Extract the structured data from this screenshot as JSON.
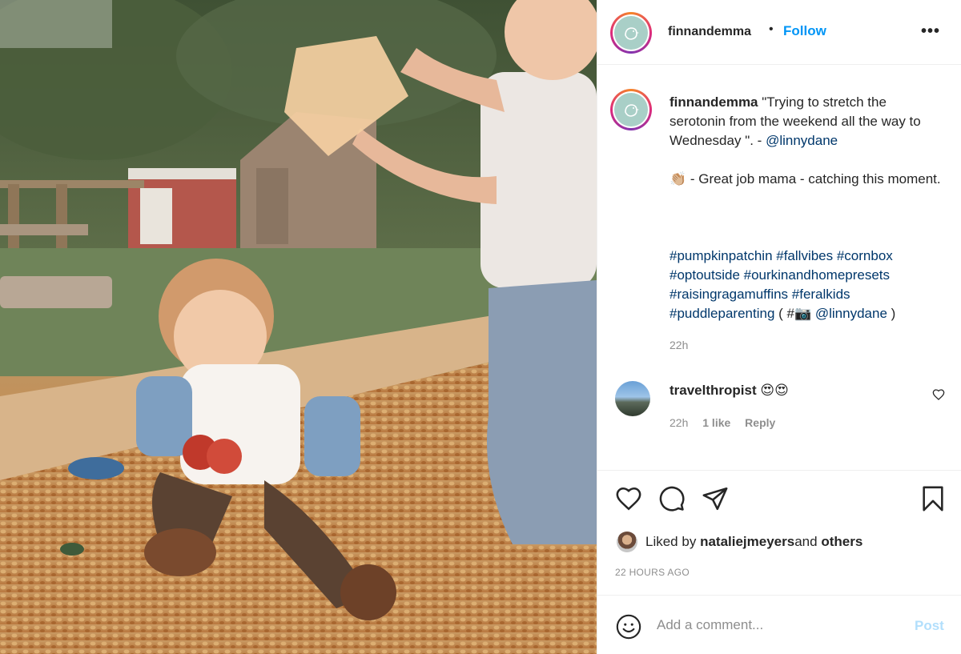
{
  "post": {
    "username": "finnandemma",
    "follow_label": "Follow",
    "more_label": "•••"
  },
  "caption": {
    "username": "finnandemma",
    "text": "\"Trying to stretch the serotonin from the weekend all the way to Wednesday \". - ",
    "mention": "@linnydane",
    "line2_emoji": "👏🏼",
    "line2_text": " - Great job mama - catching this moment.",
    "tags_text": "#pumpkinpatchin #fallvibes #cornbox #optoutside #ourkinandhomepresets #raisingragamuffins #feralkids #puddleparenting",
    "credit_prefix": " ( #",
    "credit_emoji": "📷",
    "credit_mention": " @linnydane",
    "credit_suffix": " )",
    "time": "22h"
  },
  "comment": {
    "username": "travelthropist",
    "text": " 😍😍",
    "time": "22h",
    "likes": "1 like",
    "reply": "Reply"
  },
  "likes": {
    "prefix": "Liked by ",
    "user": "nataliejmeyers",
    "middle": " and ",
    "others": "others"
  },
  "timestamp": "22 HOURS AGO",
  "add_comment": {
    "placeholder": "Add a comment...",
    "post_label": "Post"
  },
  "colors": {
    "accent": "#0095f6",
    "link": "#00376b",
    "muted": "#8e8e8e",
    "post_disabled": "#b2dffc"
  }
}
